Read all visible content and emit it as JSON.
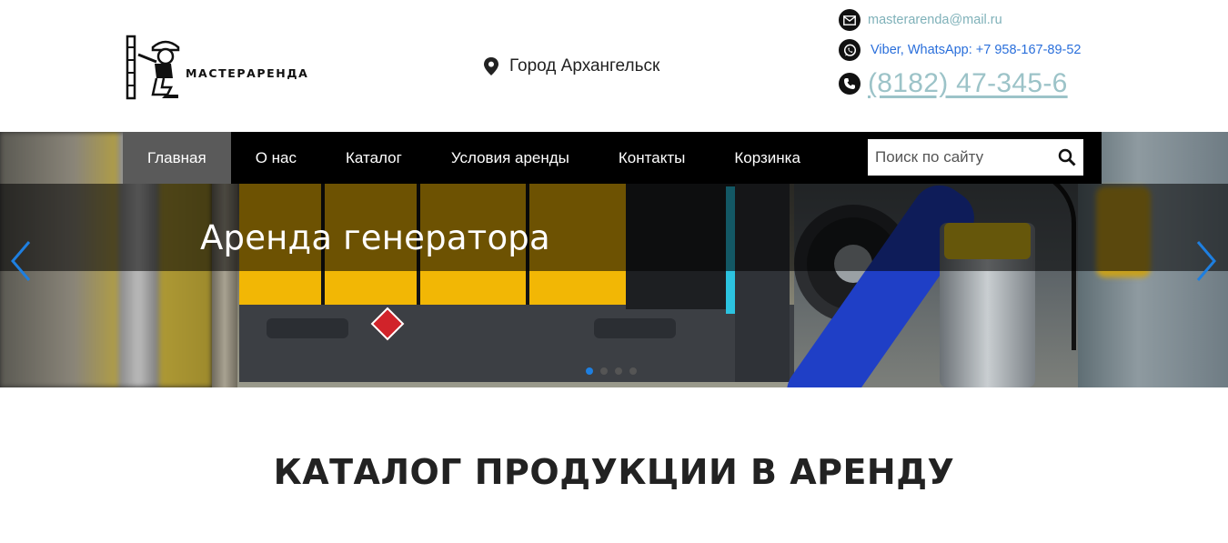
{
  "header": {
    "logo_text": "МАСТЕРАРЕНДА",
    "city": "Город Архангельск",
    "contacts": {
      "email": "masterarenda@mail.ru",
      "messengers": "Viber, WhatsApp: +7 958-167-89-52",
      "phone": "(8182) 47-345-6"
    }
  },
  "nav": {
    "items": [
      {
        "label": "Главная",
        "active": true
      },
      {
        "label": "О нас"
      },
      {
        "label": "Каталог"
      },
      {
        "label": "Условия аренды"
      },
      {
        "label": "Контакты"
      },
      {
        "label": "Корзинка"
      }
    ],
    "search_placeholder": "Поиск по сайту"
  },
  "slider": {
    "title": "Аренда генератора",
    "slide_count": 4,
    "active_index": 0
  },
  "catalog": {
    "title": "КАТАЛОГ ПРОДУКЦИИ В АРЕНДУ"
  },
  "colors": {
    "accent_blue": "#1e7fe0",
    "phone": "#9cc3c8",
    "email": "#7fb1b9",
    "nav_bg": "#000000",
    "nav_active": "#5a5a5a"
  },
  "icons": [
    "location-pin-icon",
    "email-icon",
    "whatsapp-icon",
    "phone-icon",
    "search-icon",
    "chevron-left-icon",
    "chevron-right-icon"
  ]
}
